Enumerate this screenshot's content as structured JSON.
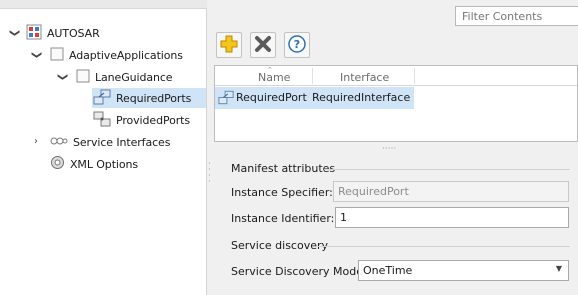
{
  "tree": {
    "root": {
      "label": "AUTOSAR",
      "expanded": true
    },
    "adaptive_applications": {
      "label": "AdaptiveApplications",
      "expanded": true
    },
    "lane_guidance": {
      "label": "LaneGuidance",
      "expanded": true
    },
    "required_ports": {
      "label": "RequiredPorts",
      "selected": true
    },
    "provided_ports": {
      "label": "ProvidedPorts"
    },
    "service_interfaces": {
      "label": "Service Interfaces",
      "expanded": false
    },
    "xml_options": {
      "label": "XML Options"
    }
  },
  "filter": {
    "placeholder": "Filter Contents"
  },
  "toolbar": {
    "add_icon": "plus-icon",
    "delete_icon": "delete-x-icon",
    "help_icon": "help-icon"
  },
  "table": {
    "columns": [
      "Name",
      "Interface"
    ],
    "rows": [
      {
        "name": "RequiredPort",
        "interface": "RequiredInterface",
        "selected": true
      }
    ]
  },
  "manifest": {
    "section_label": "Manifest attributes",
    "instance_specifier_label": "Instance Specifier:",
    "instance_specifier_value": "RequiredPort",
    "instance_identifier_label": "Instance Identifier:",
    "instance_identifier_value": "1"
  },
  "service_discovery": {
    "section_label": "Service discovery",
    "mode_label": "Service Discovery Mode:",
    "mode_value": "OneTime"
  },
  "colors": {
    "selection": "#cfe5f7",
    "add_icon": "#f5c518",
    "delete_icon": "#555555",
    "help_icon": "#2f6db3"
  }
}
